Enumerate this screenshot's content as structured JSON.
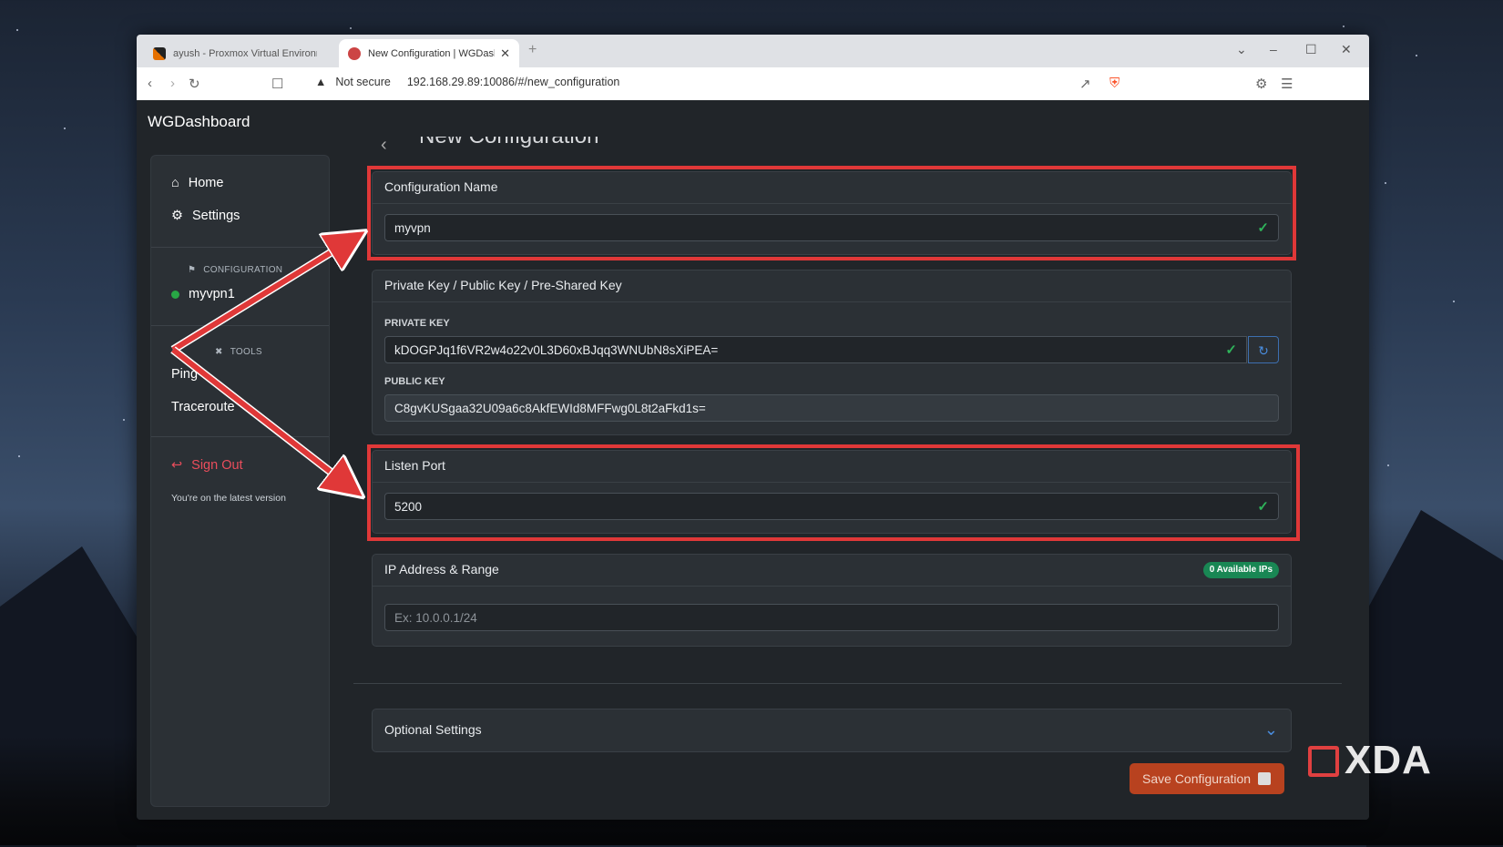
{
  "browser": {
    "tabs": [
      {
        "title": "ayush - Proxmox Virtual Environme",
        "favicon": "proxmox-icon"
      },
      {
        "title": "New Configuration | WGDashb",
        "favicon": "wgdashboard-icon"
      }
    ],
    "address": {
      "security_label": "Not secure",
      "url": "192.168.29.89:10086/#/new_configuration"
    }
  },
  "app": {
    "brand": "WGDashboard"
  },
  "sidebar": {
    "nav": [
      {
        "label": "Home",
        "icon": "home-icon"
      },
      {
        "label": "Settings",
        "icon": "gear-icon"
      }
    ],
    "configurations_heading": "CONFIGURATION",
    "configurations": [
      {
        "name": "myvpn1",
        "status_color": "#28a745"
      }
    ],
    "tools_heading": "TOOLS",
    "tools": [
      {
        "label": "Ping"
      },
      {
        "label": "Traceroute"
      }
    ],
    "sign_out": "Sign Out",
    "version_text": "You're on the latest version"
  },
  "page": {
    "title": "New Configuration",
    "config_name": {
      "heading": "Configuration Name",
      "value": "myvpn"
    },
    "keys": {
      "heading": "Private Key / Public Key / Pre-Shared Key",
      "private_label": "PRIVATE KEY",
      "private_value": "kDOGPJq1f6VR2w4o22v0L3D60xBJqq3WNUbN8sXiPEA=",
      "public_label": "PUBLIC KEY",
      "public_value": "C8gvKUSgaa32U09a6c8AkfEWId8MFFwg0L8t2aFkd1s="
    },
    "listen_port": {
      "heading": "Listen Port",
      "value": "5200"
    },
    "ip_range": {
      "heading": "IP Address & Range",
      "badge": "0 Available IPs",
      "placeholder": "Ex: 10.0.0.1/24"
    },
    "optional": {
      "heading": "Optional Settings"
    },
    "save_label": "Save Configuration"
  },
  "watermark": {
    "text": "XDA"
  },
  "colors": {
    "highlight": "#e03838",
    "accent_success": "#2fb35a",
    "save_button": "#b8421f"
  }
}
